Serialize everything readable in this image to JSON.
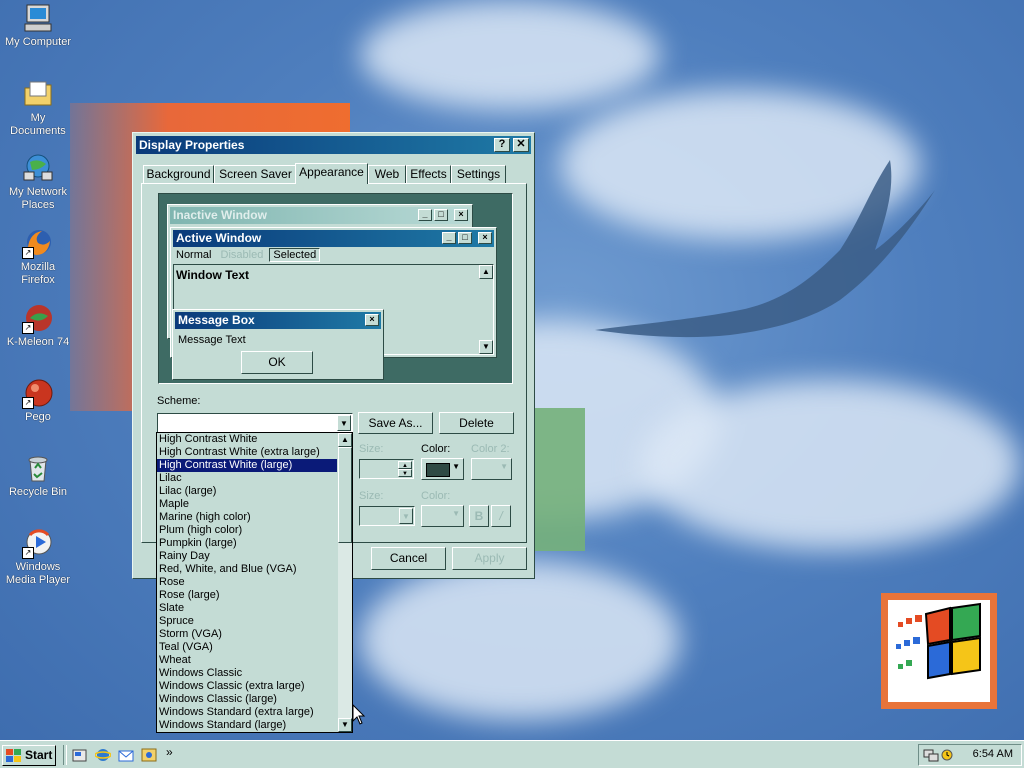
{
  "desktop": {
    "icons": [
      {
        "label": "My Computer",
        "icon": "my-computer-icon"
      },
      {
        "label": "My Documents",
        "icon": "my-documents-icon"
      },
      {
        "label": "My Network",
        "label2": "Places",
        "icon": "network-places-icon"
      },
      {
        "label": "Mozilla Firefox",
        "icon": "firefox-icon"
      },
      {
        "label": "K-Meleon 74",
        "icon": "k-meleon-icon"
      },
      {
        "label": "Pego",
        "icon": "pego-icon"
      },
      {
        "label": "Recycle Bin",
        "icon": "recycle-bin-icon"
      },
      {
        "label": "Windows",
        "label2": "Media Player",
        "icon": "media-player-icon"
      }
    ]
  },
  "dialog": {
    "title": "Display Properties",
    "help_btn": "?",
    "close_btn": "✕",
    "tabs": [
      "Background",
      "Screen Saver",
      "Appearance",
      "Web",
      "Effects",
      "Settings"
    ],
    "active_tab": "Appearance",
    "preview": {
      "inactive_title": "Inactive Window",
      "active_title": "Active Window",
      "menu": [
        "Normal",
        "Disabled",
        "Selected"
      ],
      "window_text": "Window Text",
      "msgbox_title": "Message Box",
      "msgbox_text": "Message Text",
      "ok": "OK"
    },
    "scheme_label": "Scheme:",
    "scheme_value": "",
    "save_as": "Save As...",
    "delete": "Delete",
    "size_label": "Size:",
    "color_label": "Color:",
    "color2_label": "Color 2:",
    "size2_label": "Size:",
    "color3_label": "Color:",
    "bold_btn": "B",
    "italic_btn": "/",
    "cancel": "Cancel",
    "apply": "Apply",
    "color_swatch": "#2f4a44",
    "scheme_options": [
      "High Contrast White",
      "High Contrast White (extra large)",
      "High Contrast White (large)",
      "Lilac",
      "Lilac (large)",
      "Maple",
      "Marine (high color)",
      "Plum (high color)",
      "Pumpkin (large)",
      "Rainy Day",
      "Red, White, and Blue (VGA)",
      "Rose",
      "Rose (large)",
      "Slate",
      "Spruce",
      "Storm (VGA)",
      "Teal (VGA)",
      "Wheat",
      "Windows Classic",
      "Windows Classic (extra large)",
      "Windows Classic (large)",
      "Windows Standard (extra large)",
      "Windows Standard (large)"
    ],
    "selected_index": 2
  },
  "taskbar": {
    "start": "Start",
    "clock": "6:54 AM",
    "quick_launch": [
      "show-desktop-icon",
      "internet-explorer-icon",
      "outlook-express-icon",
      "channels-icon"
    ],
    "chevron": "»"
  },
  "colors": {
    "face": "#c4dcd5",
    "active_title_start": "#0a3a7a",
    "active_title_end": "#1f7aa6",
    "selection": "#0a1a78"
  }
}
